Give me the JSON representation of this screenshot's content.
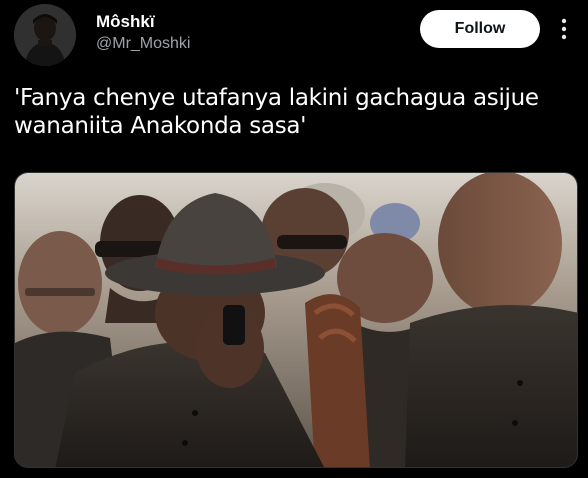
{
  "author": {
    "display_name": "Môshkï",
    "handle": "@Mr_Moshki"
  },
  "actions": {
    "follow_label": "Follow",
    "more_icon": "more-vertical-icon"
  },
  "tweet": {
    "text": "'Fanya chenye utafanya lakini gachagua asijue wananiita Anakonda sasa'"
  },
  "media": {
    "description_icon": "photo"
  },
  "colors": {
    "background": "#000000",
    "text_primary": "#ffffff",
    "text_secondary": "#9ea3a8",
    "button_bg": "#ffffff",
    "button_text": "#0f1419"
  }
}
